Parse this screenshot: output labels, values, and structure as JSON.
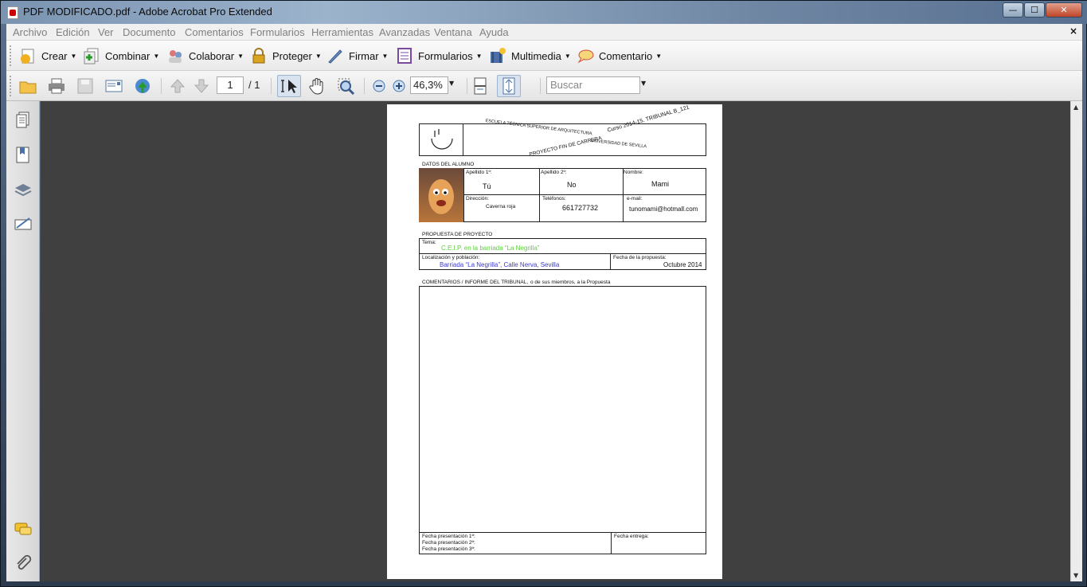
{
  "window": {
    "title": "PDF MODIFICADO.pdf - Adobe Acrobat Pro Extended",
    "controls": {
      "minimize": "—",
      "maximize": "☐",
      "close": "✕"
    }
  },
  "menu": {
    "items": [
      "Archivo",
      "Edición",
      "Ver",
      "Documento",
      "Comentarios",
      "Formularios",
      "Herramientas",
      "Avanzadas",
      "Ventana",
      "Ayuda"
    ],
    "close_doc": "×"
  },
  "tasks": {
    "items": [
      {
        "label": "Crear",
        "icon": "create-pdf-icon"
      },
      {
        "label": "Combinar",
        "icon": "combine-icon"
      },
      {
        "label": "Colaborar",
        "icon": "collaborate-icon"
      },
      {
        "label": "Proteger",
        "icon": "lock-icon"
      },
      {
        "label": "Firmar",
        "icon": "pen-icon"
      },
      {
        "label": "Formularios",
        "icon": "forms-icon"
      },
      {
        "label": "Multimedia",
        "icon": "multimedia-icon"
      },
      {
        "label": "Comentario",
        "icon": "comment-icon"
      }
    ]
  },
  "toolbar": {
    "page_current": "1",
    "page_total": "/ 1",
    "zoom": "46,3%",
    "search_placeholder": "Buscar"
  },
  "document": {
    "header_line1": "ESCUELA TÉCNICA SUPERIOR DE ARQUITECTURA.",
    "header_course": "Curso 2014-15. TRIBUNAL B_121",
    "header_line2": "PROYECTO FIN DE CARRERA",
    "header_univ": "UNIVERSIDAD DE SEVILLA",
    "section_student": "DATOS DEL ALUMNO",
    "apellido1_label": "Apellido 1º:",
    "apellido1_value": "Tú",
    "apellido2_label": "Apellido 2º:",
    "apellido2_value": "No",
    "nombre_label": "Nombre:",
    "nombre_value": "Mami",
    "direccion_label": "Dirección:",
    "direccion_value": "Caverna roja",
    "telefonos_label": "Teléfonos:",
    "telefonos_value": "661727732",
    "email_label": "e-mail:",
    "email_value": "tunomami@hotmall.com",
    "section_proposal": "PROPUESTA DE PROYECTO",
    "tema_label": "Tema:",
    "tema_value": "C.E.I.P. en la barriada “La Negrilla”",
    "localizacion_label": "Localización y población:",
    "localizacion_value": "Barriada “La Negrilla”, Calle Nerva, Sevilla",
    "fecha_propuesta_label": "Fecha de la propuesta:",
    "fecha_propuesta_value": "Octubre 2014",
    "section_comments_a": "COMENTARIOS / INFORME DEL TRIBUNAL,",
    "section_comments_b": "o de sus miembros, a la Propuesta",
    "fecha_pres1": "Fecha presentación 1ª:",
    "fecha_pres2": "Fecha presentación 2ª:",
    "fecha_pres3": "Fecha presentación 3ª:",
    "fecha_entrega": "Fecha entrega:"
  },
  "colors": {
    "tema_value": "#5ccf3a",
    "localizacion_value": "#3a3acf"
  }
}
